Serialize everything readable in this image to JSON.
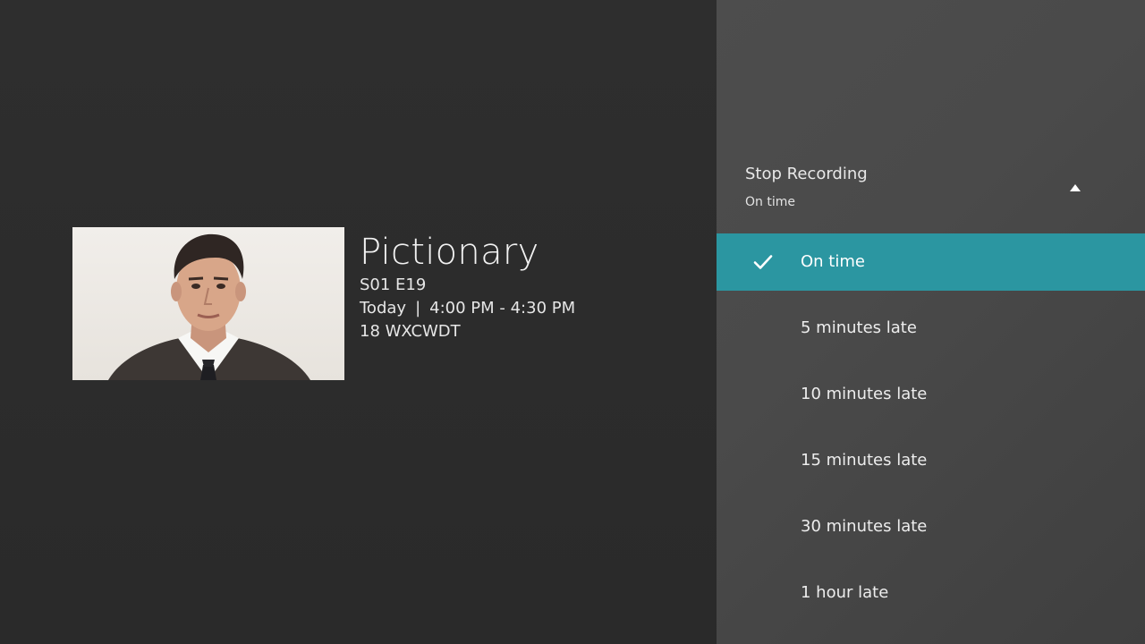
{
  "program": {
    "title": "Pictionary",
    "episode": "S01 E19",
    "day": "Today",
    "separator": "|",
    "time": "4:00 PM - 4:30 PM",
    "channel": "18 WXCWDT",
    "thumbnail_icon": "program-thumbnail"
  },
  "panel": {
    "title": "Stop Recording",
    "current_value": "On time",
    "collapse_icon": "triangle-up-icon",
    "options": [
      {
        "label": "On time",
        "selected": true
      },
      {
        "label": "5 minutes late",
        "selected": false
      },
      {
        "label": "10 minutes late",
        "selected": false
      },
      {
        "label": "15 minutes late",
        "selected": false
      },
      {
        "label": "30 minutes late",
        "selected": false
      },
      {
        "label": "1 hour late",
        "selected": false
      }
    ]
  },
  "colors": {
    "background": "#2b2b2b",
    "panel": "#4a4a4a",
    "accent": "#2b96a1",
    "text": "#ececec"
  }
}
